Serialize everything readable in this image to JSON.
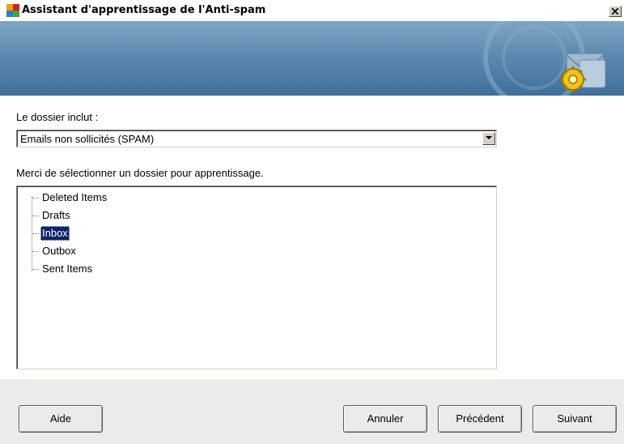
{
  "window": {
    "title": "Assistant d'apprentissage de l'Anti-spam",
    "close_glyph": "✕"
  },
  "banner": {
    "icon": "mail-settings-icon",
    "colors": {
      "top": "#7fa6c4",
      "bottom": "#3f6f9a"
    }
  },
  "folder_type": {
    "label": "Le dossier inclut :",
    "selected": "Emails non sollicités (SPAM)"
  },
  "folder_list": {
    "label": "Merci de sélectionner un dossier pour apprentissage.",
    "items": [
      {
        "label": "Deleted Items",
        "selected": false
      },
      {
        "label": "Drafts",
        "selected": false
      },
      {
        "label": "Inbox",
        "selected": true
      },
      {
        "label": "Outbox",
        "selected": false
      },
      {
        "label": "Sent Items",
        "selected": false
      }
    ]
  },
  "buttons": {
    "help": "Aide",
    "cancel": "Annuler",
    "previous": "Précédent",
    "next": "Suivant"
  },
  "colors": {
    "selection": "#0a246a",
    "footer_bg": "#ecebe9"
  }
}
